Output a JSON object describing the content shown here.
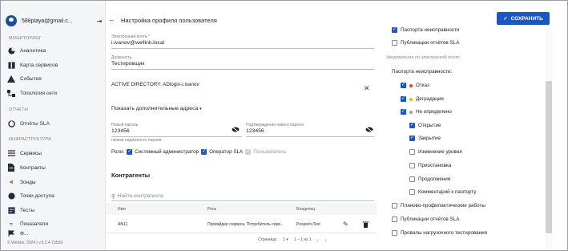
{
  "sidebar": {
    "user_email": "588playa@gmail.c...",
    "sections": {
      "monitoring": "МОНИТОРИНГ",
      "reports": "ОТЧЁТЫ",
      "infrastructure": "ИНФРАСТРУКТУРА"
    },
    "items": [
      {
        "label": "Аналитика",
        "icon": "analytics-icon"
      },
      {
        "label": "Карта сервисов",
        "icon": "map-icon"
      },
      {
        "label": "События",
        "icon": "warning-icon"
      },
      {
        "label": "Топология сети",
        "icon": "topology-icon"
      },
      {
        "label": "Отчёты SLA",
        "icon": "report-icon"
      },
      {
        "label": "Сервисы",
        "icon": "list-icon"
      },
      {
        "label": "Контракты",
        "icon": "document-icon"
      },
      {
        "label": "Зонды",
        "icon": "probe-icon"
      },
      {
        "label": "Точки доступа",
        "icon": "access-point-icon"
      },
      {
        "label": "Тесты",
        "icon": "test-icon"
      },
      {
        "label": "Показатели",
        "icon": "metrics-icon"
      },
      {
        "label": "Ф..."
      }
    ],
    "footer": "© Wellink, 2024 | v.5.2.4.73539"
  },
  "header": {
    "title": "Настройка профиля пользователя",
    "save_label": "СОХРАНИТЬ"
  },
  "profile": {
    "email_label": "Электронная почта *",
    "email_value": "i.ivanov@wellink.local",
    "position_label": "Должность",
    "position_value": "Тестировщик",
    "active_directory": "ACTIVE DIRECTORY: ADlogin-i.ivanov",
    "extra_addresses": "Показать дополнительные адреса",
    "new_password_label": "Новый пароль",
    "new_password_value": "123456",
    "confirm_password_label": "Подтверждение нового пароля",
    "confirm_password_value": "123456",
    "password_strength": "низкая надёжность пароля.",
    "roles_label": "Роли:",
    "roles": [
      {
        "label": "Системный администратор",
        "checked": true
      },
      {
        "label": "Оператор SLA",
        "checked": true
      },
      {
        "label": "Пользователь",
        "checked": false,
        "disabled": true
      }
    ]
  },
  "counterparties": {
    "title": "Контрагенты",
    "search_placeholder": "Найти контрагента",
    "columns": [
      "Имя",
      "Роль",
      "Владелец"
    ],
    "rows": [
      {
        "name": "Afk11",
        "role": "Провайдер сервиса, Потребитель серв...",
        "owner": "PospelovTest"
      }
    ],
    "pagination": {
      "page_label": "Страница:",
      "page": "1",
      "range": "1 – 1 из 1"
    }
  },
  "notifications": {
    "top_items": [
      {
        "label": "Паспорта неисправности",
        "checked": true
      },
      {
        "label": "Публикации отчётов SLA",
        "checked": false
      }
    ],
    "email_heading": "Уведомления по электронной почте:",
    "passport_heading": "Паспорта неисправности:",
    "statuses": [
      {
        "label": "Отказ",
        "checked": true,
        "color": "#e53935"
      },
      {
        "label": "Деградация",
        "checked": true,
        "color": "#f5b800"
      },
      {
        "label": "Не определено",
        "checked": true,
        "color": "#9e9e9e"
      }
    ],
    "sub_items": [
      {
        "label": "Открытие",
        "checked": true
      },
      {
        "label": "Закрытие",
        "checked": true
      },
      {
        "label": "Изменение уровня",
        "checked": false
      },
      {
        "label": "Приостановка",
        "checked": false
      },
      {
        "label": "Продолжение",
        "checked": false
      },
      {
        "label": "Комментарий к паспорту",
        "checked": false
      }
    ],
    "bottom_items": [
      {
        "label": "Планово-профилактические работы",
        "checked": false
      },
      {
        "label": "Публикации отчётов SLA",
        "checked": false
      },
      {
        "label": "Провалы нагрузочного тестирования",
        "checked": false
      }
    ]
  },
  "colors": {
    "accent": "#1a56c4",
    "sidebar_bg": "#f4f5f7"
  }
}
